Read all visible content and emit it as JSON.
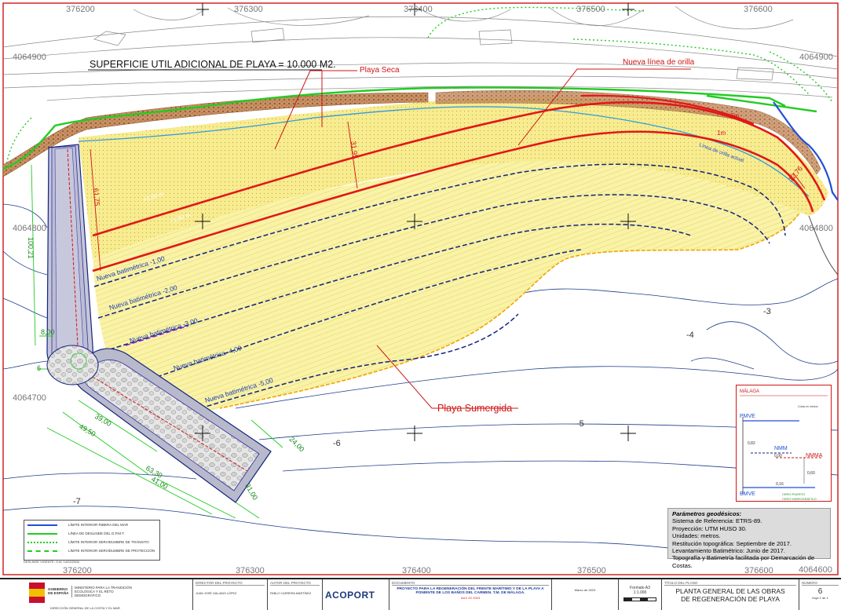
{
  "coordinates": {
    "x_top": [
      "376200",
      "376300",
      "376400",
      "376500",
      "376600"
    ],
    "x_bottom": [
      "376200",
      "376300",
      "376400",
      "376500",
      "376600"
    ],
    "y_left": [
      "4064900",
      "4064800",
      "4064700",
      "4064600"
    ],
    "y_right": [
      "4064900",
      "4064800"
    ]
  },
  "labels": {
    "surface": "SUPERFICIE UTIL ADICIONAL DE PLAYA = 10.000 M2.",
    "dry_beach": "Playa Seca",
    "new_shoreline": "Nueva línea de orilla",
    "submerged_beach": "Playa Sumergida",
    "current_shoreline": "Línea de orilla actual",
    "contour_2m": "+2,00 m",
    "contour_1m": "+1,00 m",
    "contour_2": "2m",
    "contour_1": "1m"
  },
  "bathymetry": [
    "Nueva batimétrica -1,00",
    "Nueva batimétrica -2,00",
    "Nueva batimétrica -3,00",
    "Nueva batimétrica -4,00",
    "Nueva batimétrica -5,00"
  ],
  "depth_marks": [
    "-3",
    "-4",
    "-5",
    "-6",
    "-7"
  ],
  "dimensions": {
    "red": [
      "31,95",
      "61,75",
      "12,76"
    ],
    "green": [
      "100,21",
      "8,00",
      "6",
      "39,00",
      "49,50",
      "63,30",
      "41,00",
      "24,00",
      "31,00"
    ]
  },
  "colors": {
    "beach_fill": "#faf3a6",
    "red_line": "#e01818",
    "navy": "#13237f",
    "green": "#22cc22",
    "rock": "#b87a4a",
    "blue_border": "#1f4fd6"
  },
  "legend": {
    "items": [
      "LÍMITE INTERIOR RIBERA DEL MAR",
      "LÍNEA DE DESLINDE DEL D.P.M.T.",
      "LÍMITE INTERIOR SERVIDUMBRE DE TRÁNSITO",
      "LÍMITE INTERIOR SERVIDUMBRE DE PROTECCIÓN"
    ],
    "footer": "DESLINDE VIGENTE: O.M. 14/02/2008"
  },
  "levels": {
    "place": "MÁLAGA",
    "units": "Cotas en metros",
    "pmve": "PMVE",
    "nmm": "NMM",
    "nmma": "NMMA",
    "bmve": "BMVE",
    "v1": "0,82",
    "v2": "0,00",
    "v3": "0,60",
    "v4": "0,16",
    "cero1": "CERO PUERTO",
    "cero2": "CERO HIDROGRÁFICO"
  },
  "geodesic": {
    "title": "Parámetros geodésicos:",
    "lines": [
      "Sistema de Referencia: ETRS-89.",
      "Proyección: UTM HUSO 30.",
      "Unidades: metros.",
      "Restitución topográfica: Septiembre de 2017.",
      "Levantamiento Batimétrico: Junio de 2017.",
      "Topografía y Batimetría facilitada por Demarcación de Costas."
    ]
  },
  "titleblock": {
    "gov": "GOBIERNO DE ESPAÑA",
    "ministry": "MINISTERIO PARA LA TRANSICIÓN ECOLÓGICA Y EL RETO DEMOGRÁFICO",
    "direction": "DIRECCIÓN GENERAL DE LA COSTA Y EL MAR",
    "director_head": "DIRECTOR DEL PROYECTO",
    "director": "JUAN JOSÉ GALIANO LÓPEZ",
    "author_head": "AUTOR DEL PROYECTO",
    "author": "PABLO CARRERA MARTÍNEZ",
    "company": "ACOPORT",
    "document_head": "DOCUMENTO",
    "project": "PROYECTO PARA LA REGENERACIÓN DEL FRENTE MARÍTIMO Y DE LA PLAYA A PONIENTE DE LOS BAÑOS DEL CARMEN. T.M. DE MÁLAGA.",
    "ref": "AUX 2X 2023",
    "date": "Marzo de 2023",
    "format": "Formato A3",
    "scale": "1:1.000",
    "plan_head": "TÍTULO DEL PLANO",
    "plan_title_1": "PLANTA GENERAL DE LAS OBRAS",
    "plan_title_2": "DE REGENERACIÓN DE PLAYA",
    "number_head": "NÚMERO",
    "number": "6",
    "sheet": "Hoja 1 de 1"
  }
}
